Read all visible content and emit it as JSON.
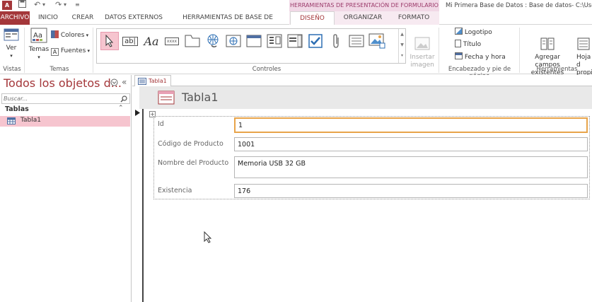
{
  "titlebar": {
    "app_icon_text": "A",
    "context_header": "HERRAMIENTAS DE PRESENTACIÓN DE FORMULARIO",
    "doc_title": "Mi Primera Base de Datos : Base de datos- C:\\Users\\"
  },
  "tabs": {
    "file": "ARCHIVO",
    "inicio": "INICIO",
    "crear": "CREAR",
    "datos_externos": "DATOS EXTERNOS",
    "herramientas": "HERRAMIENTAS DE BASE DE DATOS",
    "diseno": "DISEÑO",
    "organizar": "ORGANIZAR",
    "formato": "FORMATO"
  },
  "ribbon": {
    "ver": "Ver",
    "temas": "Temas",
    "colores": "Colores",
    "fuentes": "Fuentes",
    "insertar_imagen": "Insertar\nimagen",
    "logotipo": "Logotipo",
    "titulo": "Título",
    "fecha_hora": "Fecha y hora",
    "agregar_campos": "Agregar campos\nexistentes",
    "hoja_propiedades": "Hoja d\npropie",
    "groups": {
      "vistas": "Vistas",
      "temas": "Temas",
      "controles": "Controles",
      "encabezado": "Encabezado y pie de página",
      "herramientas": "Herramientas"
    },
    "control_text": {
      "textbox": "ab|",
      "label": "Aa",
      "button": "xxxx"
    }
  },
  "nav": {
    "title": "Todos los objetos d...",
    "search_placeholder": "Buscar...",
    "section": "Tablas",
    "items": [
      {
        "label": "Tabla1"
      }
    ]
  },
  "document": {
    "tab_label": "Tabla1",
    "form_title": "Tabla1",
    "fields": [
      {
        "label": "Id",
        "value": "1"
      },
      {
        "label": "Código de Producto",
        "value": "1001"
      },
      {
        "label": "Nombre del Producto",
        "value": "Memoria USB 32 GB"
      },
      {
        "label": "Existencia",
        "value": "176"
      }
    ]
  },
  "colors": {
    "accent": "#a4373a",
    "context": "#f1d8e6",
    "selected": "#f6c5cf",
    "focus_border": "#e8a44a"
  }
}
